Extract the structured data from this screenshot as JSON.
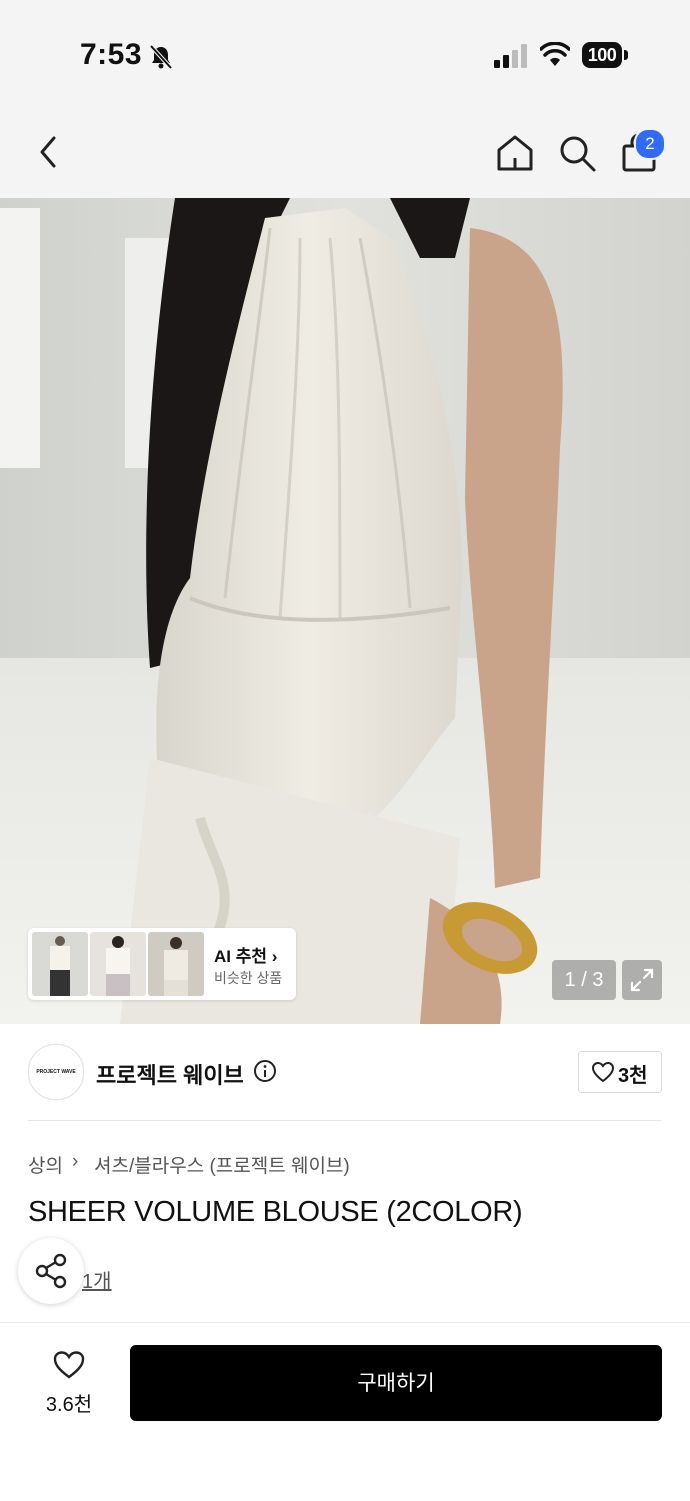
{
  "status_bar": {
    "time": "7:53",
    "battery": "100"
  },
  "header": {
    "bag_count": "2"
  },
  "hero": {
    "pager": "1 / 3",
    "ai_reco": {
      "title": "AI 추천 ›",
      "subtitle": "비슷한 상품"
    }
  },
  "brand": {
    "logo_text": "PROJECT WAVE",
    "name": "프로젝트 웨이브",
    "like_count": "3천"
  },
  "product": {
    "category_1": "상의",
    "separator": "›",
    "category_2": "셔츠/블라우스 (프로젝트 웨이브)",
    "title": "SHEER VOLUME BLOUSE (2COLOR)",
    "review_link": "1개"
  },
  "bottom": {
    "wish_count": "3.6천",
    "buy_label": "구매하기"
  },
  "colors": {
    "accent": "#2f6bf5",
    "cta": "#000000"
  }
}
